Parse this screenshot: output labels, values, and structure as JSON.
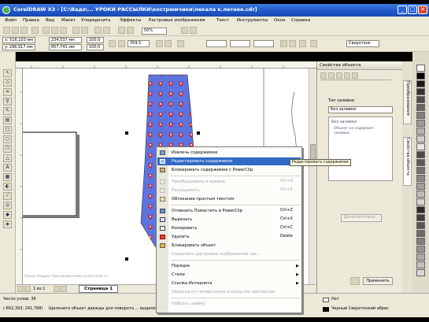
{
  "window": {
    "title": "CorelDRAW X3 - [C:\\Вадя\\... УРОКИ РАССЫЛКИ\\кострюмчики\\лекала к.летнее.cdr]",
    "buttons": [
      "_",
      "□",
      "✕"
    ]
  },
  "menubar": [
    "Файл",
    "Правка",
    "Вид",
    "Макет",
    "Упорядочить",
    "Эффекты",
    "Растровые изображения",
    "Текст",
    "Инструменты",
    "Окно",
    "Справка"
  ],
  "property_bar": {
    "x": "x: 516,103 мм",
    "y": "y: 296,917 мм",
    "w": "234,537 мм",
    "h": "857,741 мм",
    "scale_w": "100,0",
    "scale_h": "100,0",
    "angle": "359,5",
    "line_width": "Сверхтонк",
    "zoom": "50%"
  },
  "context_menu": {
    "items": [
      {
        "label": "Извлечь содержимое",
        "shortcut": "",
        "icon": "extract-contents-icon",
        "state": "normal"
      },
      {
        "label": "Редактировать содержимое",
        "shortcut": "",
        "icon": "edit-contents-icon",
        "state": "highlighted"
      },
      {
        "label": "Блокировать содержимое с PowerClip",
        "shortcut": "",
        "icon": "lock-contents-icon",
        "state": "normal"
      },
      {
        "label": "Преобразовать в кривые",
        "shortcut": "Ctrl+Q",
        "icon": "convert-to-curves-icon",
        "state": "disabled"
      },
      {
        "label": "Разъединить",
        "shortcut": "Ctrl+K",
        "icon": "break-apart-icon",
        "state": "disabled"
      },
      {
        "label": "Обтекание простым текстом",
        "shortcut": "",
        "icon": "wrap-text-icon",
        "state": "normal"
      },
      {
        "label": "Отменить Поместить в PowerClip",
        "shortcut": "Ctrl+Z",
        "icon": "undo-icon",
        "state": "normal"
      },
      {
        "label": "Вырезать",
        "shortcut": "Ctrl+X",
        "icon": "cut-icon",
        "state": "normal"
      },
      {
        "label": "Копировать",
        "shortcut": "Ctrl+C",
        "icon": "copy-icon",
        "state": "normal"
      },
      {
        "label": "Удалить",
        "shortcut": "Delete",
        "icon": "delete-icon",
        "state": "normal"
      },
      {
        "label": "Блокировать объект",
        "shortcut": "",
        "icon": "lock-object-icon",
        "state": "normal"
      },
      {
        "label": "Сохранить растровое изображение как...",
        "shortcut": "",
        "icon": "",
        "state": "disabled"
      },
      {
        "label": "Порядок",
        "shortcut": "",
        "icon": "",
        "state": "submenu"
      },
      {
        "label": "Стили",
        "shortcut": "",
        "icon": "",
        "state": "submenu"
      },
      {
        "label": "Ссылка Интернета",
        "shortcut": "",
        "icon": "",
        "state": "submenu"
      },
      {
        "label": "Переход по гиперссылке в средстве просмотра",
        "shortcut": "",
        "icon": "",
        "state": "disabled"
      },
      {
        "label": "Набрать заявку",
        "shortcut": "",
        "icon": "",
        "state": "disabled"
      }
    ],
    "tooltip": "Редактировать содержимое"
  },
  "docker": {
    "title": "Свойства объекта",
    "section_label": "Тип заливки:",
    "fill_type": "Без заливки",
    "preview_title": "Без заливки",
    "preview_text": "Объект не содержит заливки.",
    "advanced_button": "Дополнительно...",
    "apply_button": "Применить"
  },
  "side_tabs": [
    "Преобразования",
    "Свойства объекта"
  ],
  "page_nav": {
    "page_count": "1 из 1",
    "page_tab": "Страница 1"
  },
  "watermark": "Уроки Андрея Прохорова  www.vyroki-corel.ru",
  "status": {
    "line1": "Число узлов: 36",
    "coords": "(-892,393; 241,768)",
    "hint": "Щелкните объект дважды для поворота ... выделения ... Двойной щелчок ...",
    "fill": "Нет",
    "outline": "Черный  Сверхтонкий абрис"
  },
  "colors": {
    "tie_fill": "#5B74E0",
    "tie_dot": "#D8282A",
    "highlight": "#316AC5",
    "title_bar": "#2A5FD0"
  }
}
